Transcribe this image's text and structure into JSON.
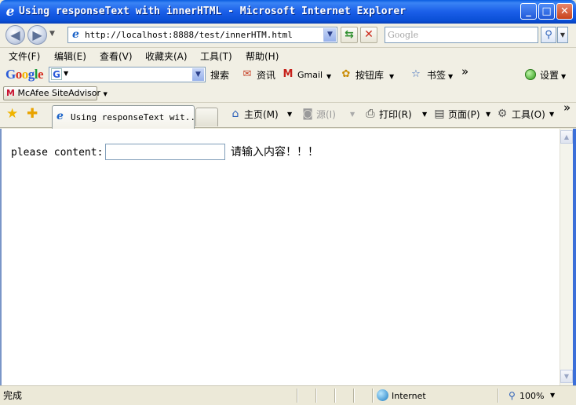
{
  "window": {
    "title": "Using responseText with innerHTML - Microsoft Internet Explorer",
    "minimize": "_",
    "maximize": "□",
    "close": "✕"
  },
  "address_bar": {
    "url": "http://localhost:8888/test/innerHTM.html",
    "search_placeholder": "Google"
  },
  "menu": {
    "items": [
      "文件(F)",
      "编辑(E)",
      "查看(V)",
      "收藏夹(A)",
      "工具(T)",
      "帮助(H)"
    ]
  },
  "google_toolbar": {
    "logo": "Google",
    "search_label": "搜索",
    "news_label": "资讯",
    "gmail_label": "Gmail",
    "buttons_label": "按钮库",
    "bookmarks_label": "书签",
    "more": "»",
    "settings_label": "设置"
  },
  "mcafee": {
    "label": "McAfee SiteAdvisor"
  },
  "tabs": {
    "active_label": "Using responseText wit..."
  },
  "command_bar": {
    "home_label": "主页(M)",
    "feeds_label": "源(I)",
    "print_label": "打印(R)",
    "page_label": "页面(P)",
    "tools_label": "工具(O)",
    "more": "»"
  },
  "content": {
    "label": "please content:",
    "input_value": "",
    "output_text": "请输入内容！！！"
  },
  "status_bar": {
    "status": "完成",
    "zone": "Internet",
    "zoom": "100%"
  },
  "colors": {
    "titlebar": "#0a5de0",
    "chrome": "#ece9d8",
    "toolbar": "#f1efe4"
  }
}
